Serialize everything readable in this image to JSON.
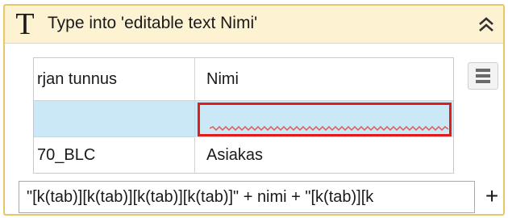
{
  "activity": {
    "title": "Type into 'editable text  Nimi'",
    "type_icon_glyph": "T",
    "collapse_icon": "double-chevron-up-icon",
    "accent_color": "#e8c766",
    "header_color": "#fdf3d3"
  },
  "grid": {
    "columns": [
      "rjan tunnus",
      "Nimi"
    ],
    "rows": [
      [
        "",
        ""
      ],
      [
        "70_BLC",
        "Asiakas"
      ]
    ],
    "selected_row_color": "#cbe8f6",
    "highlight_color": "#e01c1c",
    "menu_icon": "hamburger-menu-icon"
  },
  "expression": {
    "value": "\"[k(tab)][k(tab)][k(tab)][k(tab)]\" + nimi + \"[k(tab)][k",
    "add_icon": "plus-icon"
  }
}
